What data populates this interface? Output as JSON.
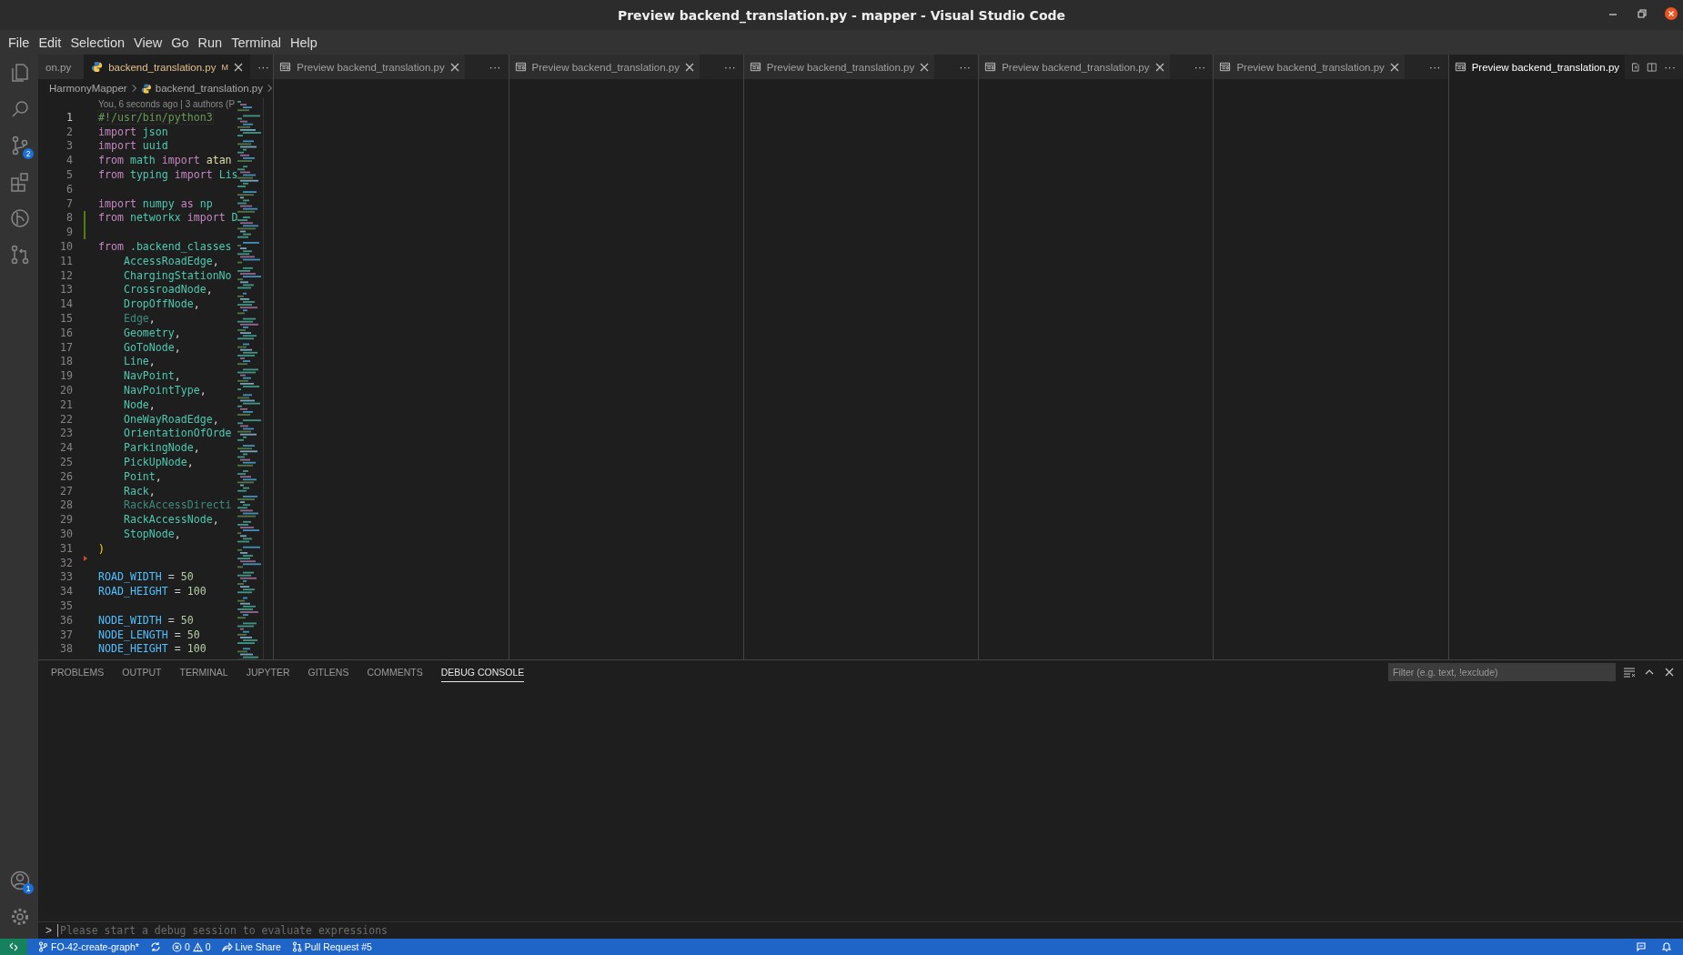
{
  "window": {
    "title": "Preview backend_translation.py - mapper - Visual Studio Code",
    "controls": [
      {
        "kind": "minimize"
      },
      {
        "kind": "restore"
      },
      {
        "kind": "close"
      }
    ]
  },
  "menu": [
    "File",
    "Edit",
    "Selection",
    "View",
    "Go",
    "Run",
    "Terminal",
    "Help"
  ],
  "activity_bar": {
    "top": [
      {
        "kind": "explorer",
        "selected": false
      },
      {
        "kind": "search",
        "selected": false
      },
      {
        "kind": "source-control",
        "selected": false,
        "badge": "2"
      },
      {
        "kind": "extensions",
        "selected": false
      },
      {
        "kind": "gitlens",
        "selected": false
      },
      {
        "kind": "pull-requests",
        "selected": false
      }
    ],
    "bottom": [
      {
        "kind": "account",
        "selected": false,
        "badge": "1"
      },
      {
        "kind": "settings",
        "selected": false
      }
    ]
  },
  "main_editor": {
    "tabs": [
      {
        "label": "on.py",
        "kind": "plain",
        "selected": false
      },
      {
        "label": "backend_translation.py",
        "kind": "python",
        "selected": true,
        "badge": "M"
      }
    ],
    "more": "···",
    "breadcrumbs": [
      "HarmonyMapper",
      "backend_translation.py"
    ],
    "blame": "You, 6 seconds ago | 3 authors (P",
    "lines": [
      {
        "number": "1",
        "current": true,
        "added": false,
        "deleted": false,
        "tokens": [
          {
            "kind": "comment",
            "text": "#!/usr/bin/python3"
          }
        ]
      },
      {
        "number": "2",
        "current": false,
        "added": false,
        "deleted": false,
        "tokens": [
          {
            "kind": "keyword",
            "text": "import"
          },
          {
            "kind": "module",
            "text": " json"
          }
        ]
      },
      {
        "number": "3",
        "current": false,
        "added": false,
        "deleted": false,
        "tokens": [
          {
            "kind": "keyword",
            "text": "import"
          },
          {
            "kind": "module",
            "text": " uuid"
          }
        ]
      },
      {
        "number": "4",
        "current": false,
        "added": false,
        "deleted": false,
        "tokens": [
          {
            "kind": "keyword",
            "text": "from"
          },
          {
            "kind": "module",
            "text": " math"
          },
          {
            "kind": "keyword",
            "text": " import"
          },
          {
            "kind": "function",
            "text": " atan"
          }
        ]
      },
      {
        "number": "5",
        "current": false,
        "added": false,
        "deleted": false,
        "tokens": [
          {
            "kind": "keyword",
            "text": "from"
          },
          {
            "kind": "module",
            "text": " typing"
          },
          {
            "kind": "keyword",
            "text": " import"
          },
          {
            "kind": "class",
            "text": " Lis"
          }
        ]
      },
      {
        "number": "6",
        "current": false,
        "added": false,
        "deleted": false
      },
      {
        "number": "7",
        "current": false,
        "added": false,
        "deleted": false,
        "tokens": [
          {
            "kind": "keyword",
            "text": "import"
          },
          {
            "kind": "module",
            "text": " numpy"
          },
          {
            "kind": "keyword",
            "text": " as"
          },
          {
            "kind": "module",
            "text": " np"
          }
        ]
      },
      {
        "number": "8",
        "current": false,
        "added": true,
        "deleted": false,
        "tokens": [
          {
            "kind": "keyword",
            "text": "from"
          },
          {
            "kind": "module",
            "text": " networkx"
          },
          {
            "kind": "keyword",
            "text": " import"
          },
          {
            "kind": "class",
            "text": " D"
          }
        ]
      },
      {
        "number": "9",
        "current": false,
        "added": true,
        "deleted": false
      },
      {
        "number": "10",
        "current": false,
        "added": false,
        "deleted": false,
        "tokens": [
          {
            "kind": "keyword",
            "text": "from"
          },
          {
            "kind": "module",
            "text": " .backend_classes"
          }
        ]
      },
      {
        "number": "11",
        "current": false,
        "added": false,
        "deleted": false,
        "tokens": [
          {
            "kind": "class",
            "text": "    AccessRoadEdge"
          },
          {
            "kind": "punct",
            "text": ","
          }
        ]
      },
      {
        "number": "12",
        "current": false,
        "added": false,
        "deleted": false,
        "tokens": [
          {
            "kind": "class",
            "text": "    ChargingStationNo"
          }
        ]
      },
      {
        "number": "13",
        "current": false,
        "added": false,
        "deleted": false,
        "tokens": [
          {
            "kind": "class",
            "text": "    CrossroadNode"
          },
          {
            "kind": "punct",
            "text": ","
          }
        ]
      },
      {
        "number": "14",
        "current": false,
        "added": false,
        "deleted": false,
        "tokens": [
          {
            "kind": "class",
            "text": "    DropOffNode"
          },
          {
            "kind": "punct",
            "text": ","
          }
        ]
      },
      {
        "number": "15",
        "current": false,
        "added": false,
        "deleted": false,
        "tokens": [
          {
            "kind": "dim",
            "text": "    Edge"
          },
          {
            "kind": "punct",
            "text": ","
          }
        ]
      },
      {
        "number": "16",
        "current": false,
        "added": false,
        "deleted": false,
        "tokens": [
          {
            "kind": "class",
            "text": "    Geometry"
          },
          {
            "kind": "punct",
            "text": ","
          }
        ]
      },
      {
        "number": "17",
        "current": false,
        "added": false,
        "deleted": false,
        "tokens": [
          {
            "kind": "class",
            "text": "    GoToNode"
          },
          {
            "kind": "punct",
            "text": ","
          }
        ]
      },
      {
        "number": "18",
        "current": false,
        "added": false,
        "deleted": false,
        "tokens": [
          {
            "kind": "class",
            "text": "    Line"
          },
          {
            "kind": "punct",
            "text": ","
          }
        ]
      },
      {
        "number": "19",
        "current": false,
        "added": false,
        "deleted": false,
        "tokens": [
          {
            "kind": "class",
            "text": "    NavPoint"
          },
          {
            "kind": "punct",
            "text": ","
          }
        ]
      },
      {
        "number": "20",
        "current": false,
        "added": false,
        "deleted": false,
        "tokens": [
          {
            "kind": "class",
            "text": "    NavPointType"
          },
          {
            "kind": "punct",
            "text": ","
          }
        ]
      },
      {
        "number": "21",
        "current": false,
        "added": false,
        "deleted": false,
        "tokens": [
          {
            "kind": "class",
            "text": "    Node"
          },
          {
            "kind": "punct",
            "text": ","
          }
        ]
      },
      {
        "number": "22",
        "current": false,
        "added": false,
        "deleted": false,
        "tokens": [
          {
            "kind": "class",
            "text": "    OneWayRoadEdge"
          },
          {
            "kind": "punct",
            "text": ","
          }
        ]
      },
      {
        "number": "23",
        "current": false,
        "added": false,
        "deleted": false,
        "tokens": [
          {
            "kind": "class",
            "text": "    OrientationOfOrde"
          }
        ]
      },
      {
        "number": "24",
        "current": false,
        "added": false,
        "deleted": false,
        "tokens": [
          {
            "kind": "class",
            "text": "    ParkingNode"
          },
          {
            "kind": "punct",
            "text": ","
          }
        ]
      },
      {
        "number": "25",
        "current": false,
        "added": false,
        "deleted": false,
        "tokens": [
          {
            "kind": "class",
            "text": "    PickUpNode"
          },
          {
            "kind": "punct",
            "text": ","
          }
        ]
      },
      {
        "number": "26",
        "current": false,
        "added": false,
        "deleted": false,
        "tokens": [
          {
            "kind": "class",
            "text": "    Point"
          },
          {
            "kind": "punct",
            "text": ","
          }
        ]
      },
      {
        "number": "27",
        "current": false,
        "added": false,
        "deleted": false,
        "tokens": [
          {
            "kind": "class",
            "text": "    Rack"
          },
          {
            "kind": "punct",
            "text": ","
          }
        ]
      },
      {
        "number": "28",
        "current": false,
        "added": false,
        "deleted": false,
        "tokens": [
          {
            "kind": "dim",
            "text": "    RackAccessDirecti"
          }
        ]
      },
      {
        "number": "29",
        "current": false,
        "added": false,
        "deleted": false,
        "tokens": [
          {
            "kind": "class",
            "text": "    RackAccessNode"
          },
          {
            "kind": "punct",
            "text": ","
          }
        ]
      },
      {
        "number": "30",
        "current": false,
        "added": false,
        "deleted": false,
        "tokens": [
          {
            "kind": "class",
            "text": "    StopNode"
          },
          {
            "kind": "punct",
            "text": ","
          }
        ]
      },
      {
        "number": "31",
        "current": false,
        "added": false,
        "deleted": false,
        "tokens": [
          {
            "kind": "paren",
            "text": ")"
          }
        ]
      },
      {
        "number": "32",
        "current": false,
        "added": false,
        "deleted": true
      },
      {
        "number": "33",
        "current": false,
        "added": false,
        "deleted": false,
        "tokens": [
          {
            "kind": "const",
            "text": "ROAD_WIDTH"
          },
          {
            "kind": "punct",
            "text": " ="
          },
          {
            "kind": "number",
            "text": " 50"
          }
        ]
      },
      {
        "number": "34",
        "current": false,
        "added": false,
        "deleted": false,
        "tokens": [
          {
            "kind": "const",
            "text": "ROAD_HEIGHT"
          },
          {
            "kind": "punct",
            "text": " ="
          },
          {
            "kind": "number",
            "text": " 100"
          }
        ]
      },
      {
        "number": "35",
        "current": false,
        "added": false,
        "deleted": false
      },
      {
        "number": "36",
        "current": false,
        "added": false,
        "deleted": false,
        "tokens": [
          {
            "kind": "const",
            "text": "NODE_WIDTH"
          },
          {
            "kind": "punct",
            "text": " ="
          },
          {
            "kind": "number",
            "text": " 50"
          }
        ]
      },
      {
        "number": "37",
        "current": false,
        "added": false,
        "deleted": false,
        "tokens": [
          {
            "kind": "const",
            "text": "NODE_LENGTH"
          },
          {
            "kind": "punct",
            "text": " ="
          },
          {
            "kind": "number",
            "text": " 50"
          }
        ]
      },
      {
        "number": "38",
        "current": false,
        "added": false,
        "deleted": false,
        "tokens": [
          {
            "kind": "const",
            "text": "NODE_HEIGHT"
          },
          {
            "kind": "punct",
            "text": " ="
          },
          {
            "kind": "number",
            "text": " 100"
          }
        ]
      }
    ]
  },
  "preview_groups": [
    {
      "tab": {
        "label": "Preview backend_translation.py",
        "selected": false
      },
      "more": "···"
    },
    {
      "tab": {
        "label": "Preview backend_translation.py",
        "selected": false
      },
      "more": "···"
    },
    {
      "tab": {
        "label": "Preview backend_translation.py",
        "selected": false
      },
      "more": "···"
    },
    {
      "tab": {
        "label": "Preview backend_translation.py",
        "selected": false
      },
      "more": "···"
    },
    {
      "tab": {
        "label": "Preview backend_translation.py",
        "selected": false
      },
      "more": "···"
    },
    {
      "tab": {
        "label": "Preview backend_translation.py",
        "selected": true
      },
      "more": "···"
    }
  ],
  "panel": {
    "tabs": [
      {
        "label": "PROBLEMS",
        "selected": false
      },
      {
        "label": "OUTPUT",
        "selected": false
      },
      {
        "label": "TERMINAL",
        "selected": false
      },
      {
        "label": "JUPYTER",
        "selected": false
      },
      {
        "label": "GITLENS",
        "selected": false
      },
      {
        "label": "COMMENTS",
        "selected": false
      },
      {
        "label": "DEBUG CONSOLE",
        "selected": true
      }
    ],
    "filter": {
      "placeholder": "Filter (e.g. text, !exclude)"
    },
    "prompt": ">",
    "input": {
      "placeholder": "Please start a debug session to evaluate expressions"
    }
  },
  "status_bar": {
    "left": [
      {
        "kind": "remote"
      },
      {
        "kind": "branch",
        "text": "FO-42-create-graph*"
      },
      {
        "kind": "sync"
      },
      {
        "kind": "problems",
        "errors": "0",
        "warnings": "0"
      },
      {
        "kind": "liveshare",
        "text": "Live Share"
      },
      {
        "kind": "pr",
        "text": "Pull Request #5"
      }
    ],
    "right": [
      {
        "kind": "feedback"
      },
      {
        "kind": "bell"
      }
    ]
  }
}
